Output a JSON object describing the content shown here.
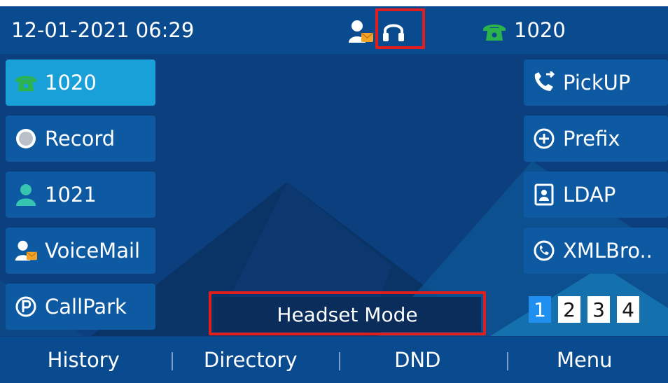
{
  "status_bar": {
    "datetime": "12-01-2021 06:29",
    "line_label": "1020",
    "icons": [
      "voicemail-icon",
      "headset-icon",
      "phone-icon"
    ]
  },
  "left_keys": [
    {
      "label": "1020",
      "icon": "phone-icon",
      "active": true
    },
    {
      "label": "Record",
      "icon": "record-icon"
    },
    {
      "label": "1021",
      "icon": "contact-icon"
    },
    {
      "label": "VoiceMail",
      "icon": "voicemail-icon"
    },
    {
      "label": "CallPark",
      "icon": "park-icon"
    }
  ],
  "right_keys": [
    {
      "label": "PickUP",
      "icon": "pickup-icon"
    },
    {
      "label": "Prefix",
      "icon": "plus-circle-icon"
    },
    {
      "label": "LDAP",
      "icon": "directory-icon"
    },
    {
      "label": "XMLBro..",
      "icon": "xml-browser-icon"
    }
  ],
  "mode_banner": "Headset Mode",
  "pages": {
    "items": [
      "1",
      "2",
      "3",
      "4"
    ],
    "current": "1"
  },
  "softkeys": [
    "History",
    "Directory",
    "DND",
    "Menu"
  ],
  "colors": {
    "accent": "#1aa0d8",
    "highlight": "#e01e1e",
    "phone_green": "#2bb24c",
    "teal": "#36c6b0"
  }
}
